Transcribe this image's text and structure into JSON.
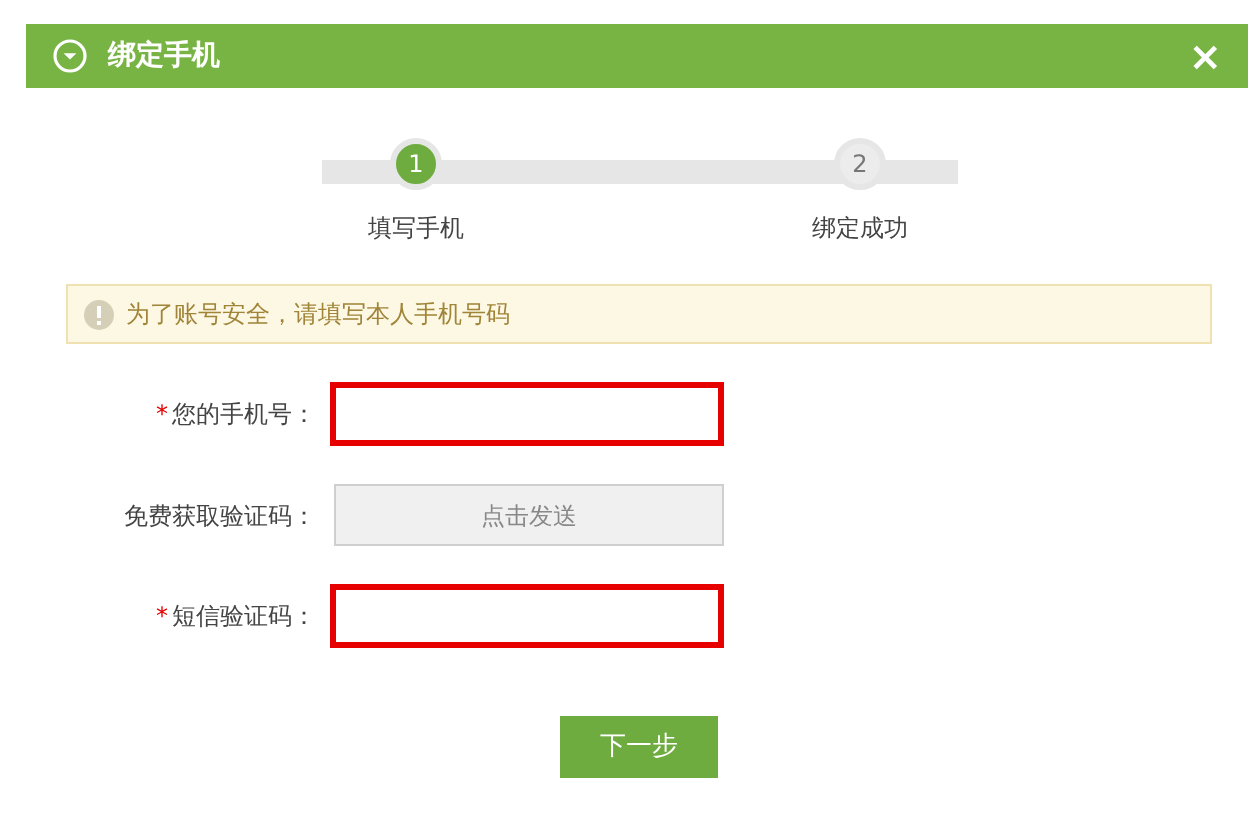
{
  "dialog": {
    "title": "绑定手机",
    "close": "×"
  },
  "steps": [
    {
      "number": "1",
      "label": "填写手机",
      "active": true
    },
    {
      "number": "2",
      "label": "绑定成功",
      "active": false
    }
  ],
  "notice": "为了账号安全，请填写本人手机号码",
  "form": [
    {
      "kind": "input",
      "required_mark": "*",
      "label": "您的手机号：",
      "error": true
    },
    {
      "kind": "button",
      "label": "免费获取验证码：",
      "button": "点击发送"
    },
    {
      "kind": "input",
      "required_mark": "*",
      "label": "短信验证码：",
      "error": true
    }
  ],
  "submit": "下一步"
}
